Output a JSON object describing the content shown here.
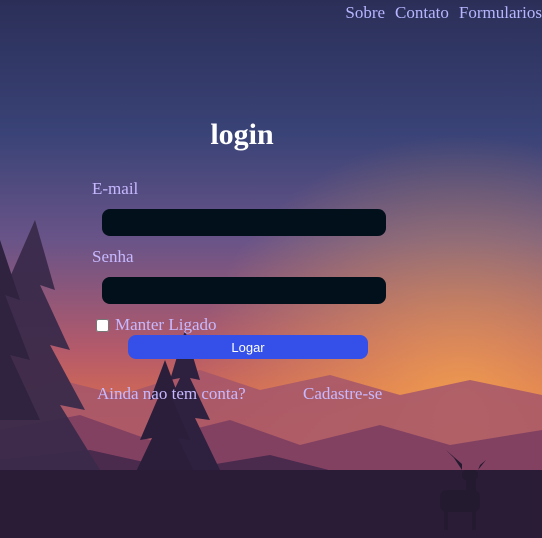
{
  "nav": {
    "items": [
      {
        "label": "Sobre"
      },
      {
        "label": "Contato"
      },
      {
        "label": "Formularios"
      }
    ]
  },
  "login": {
    "title": "login",
    "email_label": "E-mail",
    "email_value": "",
    "password_label": "Senha",
    "password_value": "",
    "remember_label": "Manter Ligado",
    "remember_checked": false,
    "submit_label": "Logar"
  },
  "signup": {
    "prompt": "Ainda nao tem conta?",
    "link_label": "Cadastre-se"
  },
  "colors": {
    "link": "#b7b5ff",
    "label": "#c7b9ff",
    "button": "#3550e8",
    "input": "#02101b"
  }
}
